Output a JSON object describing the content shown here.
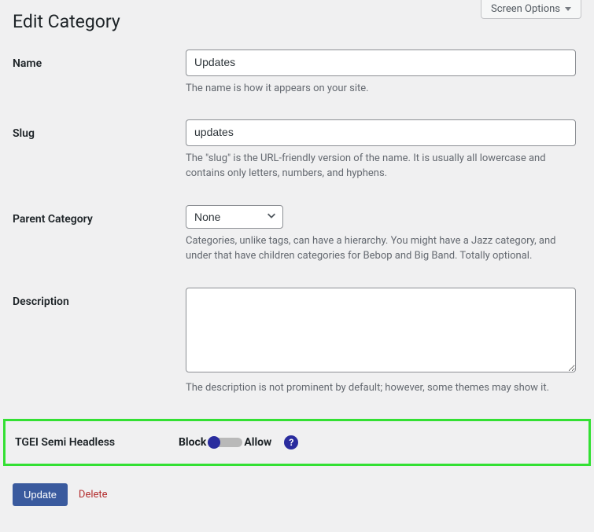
{
  "screenOptions": {
    "label": "Screen Options"
  },
  "page": {
    "title": "Edit Category"
  },
  "fields": {
    "name": {
      "label": "Name",
      "value": "Updates",
      "placeholder": "",
      "help": "The name is how it appears on your site."
    },
    "slug": {
      "label": "Slug",
      "value": "updates",
      "placeholder": "",
      "help": "The \"slug\" is the URL-friendly version of the name. It is usually all lowercase and contains only letters, numbers, and hyphens."
    },
    "parent": {
      "label": "Parent Category",
      "selected": "None",
      "options": [
        "None"
      ],
      "help": "Categories, unlike tags, can have a hierarchy. You might have a Jazz category, and under that have children categories for Bebop and Big Band. Totally optional."
    },
    "description": {
      "label": "Description",
      "value": "",
      "help": "The description is not prominent by default; however, some themes may show it."
    },
    "tgei": {
      "label": "TGEI Semi Headless",
      "blockLabel": "Block",
      "allowLabel": "Allow",
      "helpGlyph": "?"
    }
  },
  "actions": {
    "update": "Update",
    "delete": "Delete"
  }
}
